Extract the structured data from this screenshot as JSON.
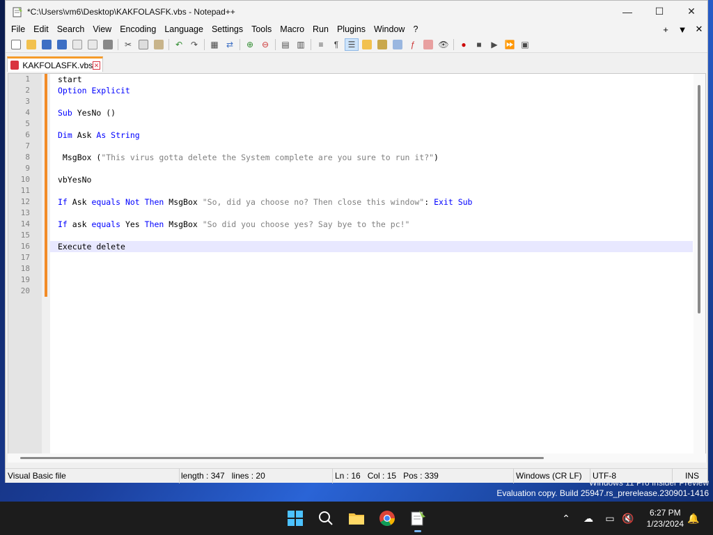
{
  "window": {
    "title": "*C:\\Users\\vm6\\Desktop\\KAKFOLASFK.vbs - Notepad++",
    "minimize": "—",
    "maximize": "☐",
    "close": "✕"
  },
  "menu": {
    "items": [
      "File",
      "Edit",
      "Search",
      "View",
      "Encoding",
      "Language",
      "Settings",
      "Tools",
      "Macro",
      "Run",
      "Plugins",
      "Window",
      "?"
    ],
    "right": [
      "+",
      "▼",
      "✕"
    ]
  },
  "tab": {
    "label": "KAKFOLASFK.vbs",
    "close": "✕"
  },
  "editor": {
    "line_numbers": [
      "1",
      "2",
      "3",
      "4",
      "5",
      "6",
      "7",
      "8",
      "9",
      "10",
      "11",
      "12",
      "13",
      "14",
      "15",
      "16",
      "17",
      "18",
      "19",
      "20"
    ],
    "current_line": 16,
    "lines": [
      [
        {
          "t": "start",
          "c": ""
        }
      ],
      [
        {
          "t": "Option Explicit",
          "c": "kw"
        }
      ],
      [],
      [
        {
          "t": "Sub",
          "c": "kw"
        },
        {
          "t": " YesNo ()",
          "c": ""
        }
      ],
      [],
      [
        {
          "t": "Dim",
          "c": "kw"
        },
        {
          "t": " Ask ",
          "c": ""
        },
        {
          "t": "As String",
          "c": "kw"
        }
      ],
      [],
      [
        {
          "t": " MsgBox (",
          "c": ""
        },
        {
          "t": "\"This virus gotta delete the System complete are you sure to run it?\"",
          "c": "str"
        },
        {
          "t": ")",
          "c": ""
        }
      ],
      [],
      [
        {
          "t": "vbYesNo",
          "c": ""
        }
      ],
      [],
      [
        {
          "t": "If",
          "c": "kw"
        },
        {
          "t": " Ask ",
          "c": ""
        },
        {
          "t": "equals Not Then",
          "c": "kw"
        },
        {
          "t": " MsgBox ",
          "c": ""
        },
        {
          "t": "\"So, did ya choose no? Then close this window\"",
          "c": "str"
        },
        {
          "t": ": ",
          "c": ""
        },
        {
          "t": "Exit Sub",
          "c": "kw"
        }
      ],
      [],
      [
        {
          "t": "If",
          "c": "kw"
        },
        {
          "t": " ask ",
          "c": ""
        },
        {
          "t": "equals",
          "c": "kw"
        },
        {
          "t": " Yes ",
          "c": ""
        },
        {
          "t": "Then",
          "c": "kw"
        },
        {
          "t": " MsgBox ",
          "c": ""
        },
        {
          "t": "\"So did you choose yes? Say bye to the pc!\"",
          "c": "str"
        }
      ],
      [],
      [
        {
          "t": "Execute delete",
          "c": ""
        }
      ],
      [],
      [],
      [],
      []
    ]
  },
  "status": {
    "file_type": "Visual Basic file",
    "length": "length : 347",
    "lines": "lines : 20",
    "ln": "Ln : 16",
    "col": "Col : 15",
    "pos": "Pos : 339",
    "eol": "Windows (CR LF)",
    "encoding": "UTF-8",
    "mode": "INS"
  },
  "desktop": {
    "watermark_line1": "Windows 11 Pro Insider Preview",
    "watermark_line2": "Evaluation copy. Build 25947.rs_prerelease.230901-1416"
  },
  "taskbar": {
    "time": "6:27 PM",
    "date": "1/23/2024",
    "apps": [
      "start-icon",
      "search-icon",
      "file-explorer-icon",
      "chrome-icon",
      "notepad-plus-plus-icon"
    ],
    "accent_color": "#7ab8f5"
  }
}
